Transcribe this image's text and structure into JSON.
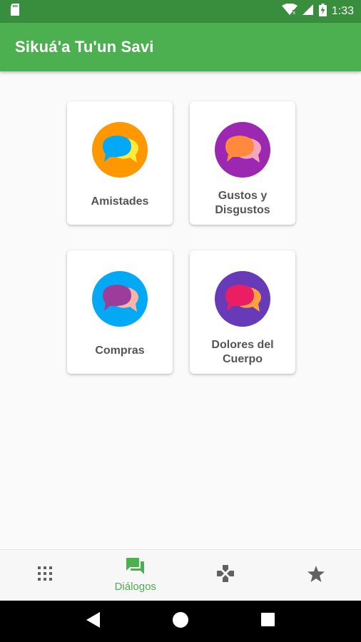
{
  "status_bar": {
    "time": "1:33",
    "icons": [
      "sd-card-icon",
      "wifi-icon",
      "signal-icon",
      "battery-charging-icon"
    ]
  },
  "app_bar": {
    "title": "Sikuá'a Tu'un Savi"
  },
  "categories": [
    {
      "label": "Amistades",
      "icon": "chat-bubbles-icon",
      "circle_color": "#ff9800",
      "bubble_front": "#03a9f4",
      "bubble_back": "#ffeb3b"
    },
    {
      "label": "Gustos y\nDisgustos",
      "icon": "chat-bubbles-icon",
      "circle_color": "#9c27b0",
      "bubble_front": "#ff8a3d",
      "bubble_back": "#f4a6c0"
    },
    {
      "label": "Compras",
      "icon": "chat-bubbles-icon",
      "circle_color": "#03a9f4",
      "bubble_front": "#9c3d9a",
      "bubble_back": "#f7b6a8"
    },
    {
      "label": "Dolores del\nCuerpo",
      "icon": "chat-bubbles-icon",
      "circle_color": "#673ab7",
      "bubble_front": "#e91e63",
      "bubble_back": "#ffa040"
    }
  ],
  "bottom_nav": {
    "items": [
      {
        "icon": "grid-apps-icon",
        "label": ""
      },
      {
        "icon": "forum-icon",
        "label": "Diálogos",
        "active": true
      },
      {
        "icon": "gamepad-icon",
        "label": ""
      },
      {
        "icon": "star-icon",
        "label": ""
      }
    ],
    "active_color": "#4caf50",
    "inactive_color": "#616161"
  },
  "system_nav": {
    "buttons": [
      "back-icon",
      "home-icon",
      "recents-icon"
    ]
  },
  "colors": {
    "status_bar": "#388e3c",
    "app_bar": "#4caf50",
    "background": "#fafafa"
  }
}
